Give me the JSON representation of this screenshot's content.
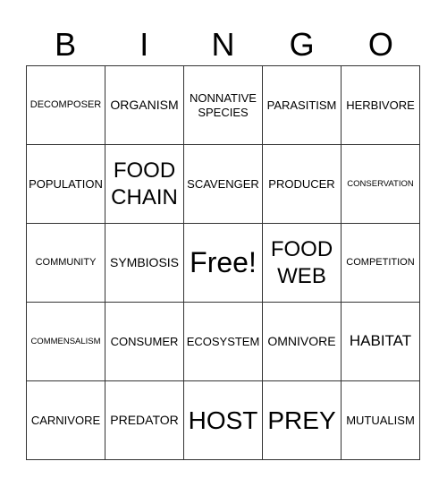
{
  "header": {
    "letters": [
      "B",
      "I",
      "N",
      "G",
      "O"
    ]
  },
  "cells": [
    [
      "DECOMPOSER",
      "ORGANISM",
      "NONNATIVE SPECIES",
      "PARASITISM",
      "HERBIVORE"
    ],
    [
      "POPULATION",
      "FOOD CHAIN",
      "SCAVENGER",
      "PRODUCER",
      "CONSERVATION"
    ],
    [
      "COMMUNITY",
      "SYMBIOSIS",
      "Free!",
      "FOOD WEB",
      "COMPETITION"
    ],
    [
      "COMMENSALISM",
      "CONSUMER",
      "ECOSYSTEM",
      "OMNIVORE",
      "HABITAT"
    ],
    [
      "CARNIVORE",
      "PREDATOR",
      "HOST",
      "PREY",
      "MUTUALISM"
    ]
  ]
}
